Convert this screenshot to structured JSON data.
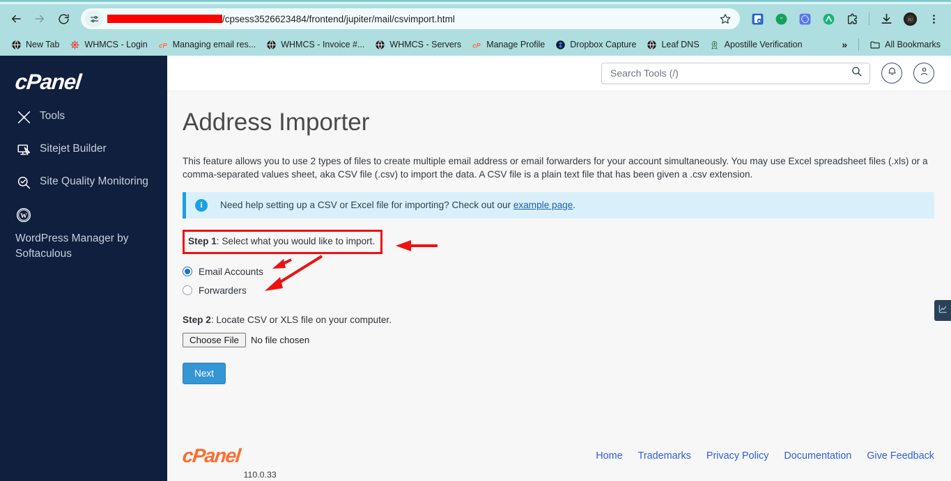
{
  "browser": {
    "nav": {
      "back": "back-arrow",
      "forward": "forward-arrow",
      "reload": "reload"
    },
    "omnibox": {
      "site_settings_icon": "site-settings-tune-icon",
      "url_redacted": "",
      "url_path": "/cpsess3526623484/frontend/jupiter/mail/csvimport.html",
      "bookmark_icon": "star-icon"
    },
    "extensions": [
      {
        "name": "bitwarden-extension-icon",
        "color": "#2563c7"
      },
      {
        "name": "grammarly-extension-icon",
        "color": "#15a05b"
      },
      {
        "name": "chatgpt-extension-icon",
        "color": "#4f6bed"
      },
      {
        "name": "nordvpn-extension-icon",
        "color": "#18b57a"
      },
      {
        "name": "extensions-puzzle-icon",
        "color": "#1f1f1f"
      }
    ],
    "downloads_icon": "download-icon",
    "profile_icon": "profile-avatar",
    "menu_icon": "three-dot-menu-icon",
    "bookmarks": [
      {
        "label": "New Tab",
        "icon": "globe-icon",
        "color": "#1f1f1f"
      },
      {
        "label": "WHMCS - Login",
        "icon": "whmcs-icon",
        "color": "#e8342a"
      },
      {
        "label": "Managing email res...",
        "icon": "cpanel-icon",
        "color": "#ff6c2c"
      },
      {
        "label": "WHMCS - Invoice #...",
        "icon": "globe-icon",
        "color": "#1f1f1f"
      },
      {
        "label": "WHMCS - Servers",
        "icon": "globe-icon",
        "color": "#1f1f1f"
      },
      {
        "label": "Manage Profile",
        "icon": "cpanel-icon",
        "color": "#ff6c2c"
      },
      {
        "label": "Dropbox Capture",
        "icon": "dropbox-icon",
        "color": "#0061ff"
      },
      {
        "label": "Leaf DNS",
        "icon": "globe-icon",
        "color": "#1f1f1f"
      },
      {
        "label": "Apostille Verification",
        "icon": "seal-icon",
        "color": "#2e6b3e"
      }
    ],
    "overflow_chevrons": "»",
    "all_bookmarks": "All Bookmarks",
    "all_bookmarks_icon": "folder-icon"
  },
  "sidebar": {
    "logo": "cPanel",
    "items": [
      {
        "label": "Tools",
        "icon": "tools-icon"
      },
      {
        "label": "Sitejet Builder",
        "icon": "sitejet-monitor-icon"
      },
      {
        "label": "Site Quality Monitoring",
        "icon": "magnifier-check-icon"
      },
      {
        "label": "WordPress Manager by Softaculous",
        "icon": "wordpress-icon"
      }
    ]
  },
  "header": {
    "search": {
      "placeholder": "Search Tools (/)",
      "value": "",
      "icon": "search-icon"
    },
    "notifications_icon": "bell-icon",
    "account_icon": "user-icon"
  },
  "main": {
    "title": "Address Importer",
    "intro": "This feature allows you to use 2 types of files to create multiple email address or email forwarders for your account simultaneously. You may use Excel spreadsheet files (.xls) or a comma-separated values sheet, aka CSV file (.csv) to import the data. A CSV file is a plain text file that has been given a .csv extension.",
    "alert": {
      "icon": "info-icon",
      "text_before": "Need help setting up a CSV or Excel file for importing? Check out our ",
      "link": "example page",
      "text_after": "."
    },
    "step1": {
      "bold": "Step 1",
      "rest": ": Select what you would like to import.",
      "options": [
        {
          "label": "Email Accounts",
          "checked": true
        },
        {
          "label": "Forwarders",
          "checked": false
        }
      ]
    },
    "step2": {
      "bold": "Step 2",
      "rest": ": Locate CSV or XLS file on your computer.",
      "choose_file_label": "Choose File",
      "file_status": "No file chosen"
    },
    "next_button": "Next"
  },
  "side_tab": {
    "icon": "line-chart-icon"
  },
  "footer": {
    "logo": "cPanel",
    "version": "110.0.33",
    "links": [
      "Home",
      "Trademarks",
      "Privacy Policy",
      "Documentation",
      "Give Feedback"
    ]
  },
  "colors": {
    "browser_chrome": "#aedee0",
    "sidebar": "#101f3d",
    "content_bg": "#f7f7f8",
    "accent_blue": "#3596d4",
    "alert_bg": "#d9f0fb",
    "alert_border": "#1ba1e2",
    "annotation_red": "#ee1111",
    "cpanel_orange": "#ff6c2c",
    "link_blue": "#2f5fd8"
  }
}
